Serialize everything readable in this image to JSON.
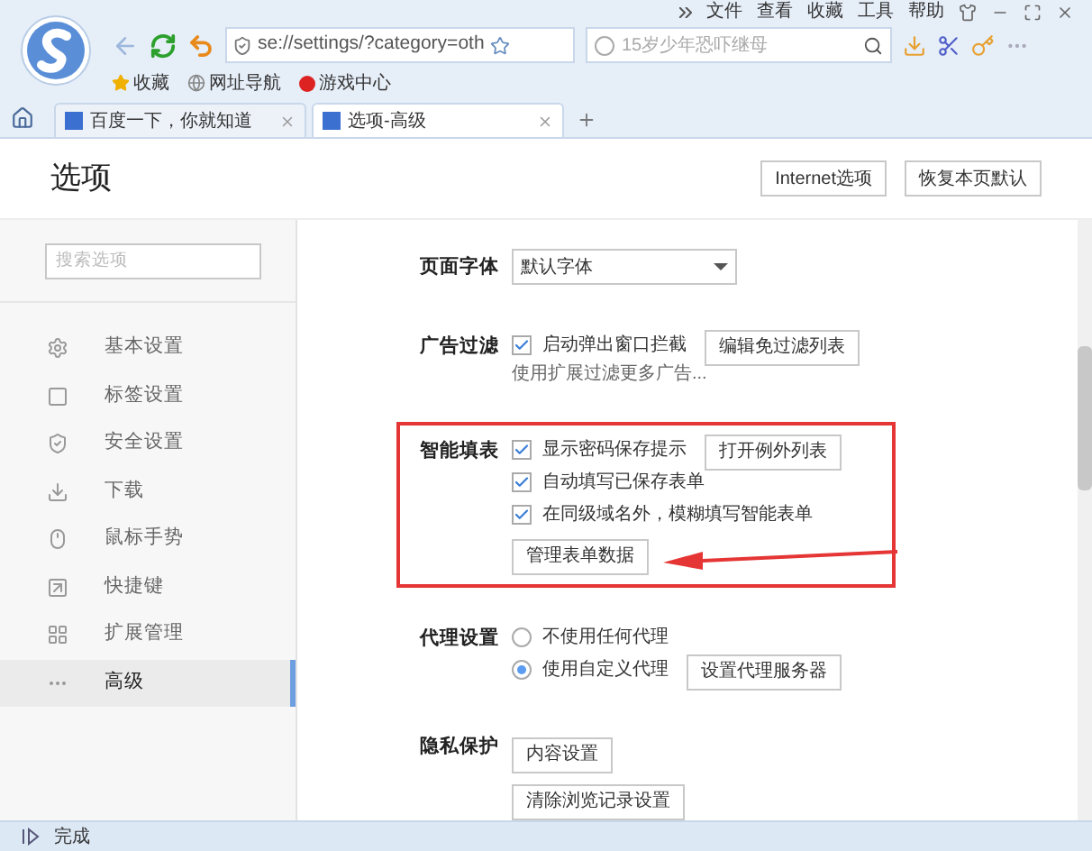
{
  "menu": [
    "文件",
    "查看",
    "收藏",
    "工具",
    "帮助"
  ],
  "address": "se://settings/?category=oth",
  "search": {
    "placeholder": "15岁少年恐吓继母"
  },
  "bookmarks": [
    "收藏",
    "网址导航",
    "游戏中心"
  ],
  "tabs": [
    {
      "label": "百度一下，你就知道",
      "selected": false
    },
    {
      "label": "选项-高级",
      "selected": true
    }
  ],
  "page": {
    "title": "选项",
    "buttons": [
      "Internet选项",
      "恢复本页默认"
    ]
  },
  "sidebar": {
    "search": {
      "placeholder": "搜索选项"
    },
    "items": [
      {
        "label": "基本设置",
        "selected": false
      },
      {
        "label": "标签设置",
        "selected": false
      },
      {
        "label": "安全设置",
        "selected": false
      },
      {
        "label": "下载",
        "selected": false
      },
      {
        "label": "鼠标手势",
        "selected": false
      },
      {
        "label": "快捷键",
        "selected": false
      },
      {
        "label": "扩展管理",
        "selected": false
      },
      {
        "label": "高级",
        "selected": true
      }
    ]
  },
  "sections": [
    {
      "label": "页面字体",
      "highlighted": false,
      "rows": [
        {
          "kind": "select",
          "value": "默认字体"
        }
      ]
    },
    {
      "label": "广告过滤",
      "highlighted": false,
      "rows": [
        {
          "kind": "checkbox",
          "text": "启动弹出窗口拦截",
          "checked": true,
          "button": "编辑免过滤列表"
        },
        {
          "kind": "link",
          "text": "使用扩展过滤更多广告..."
        }
      ]
    },
    {
      "label": "智能填表",
      "highlighted": true,
      "rows": [
        {
          "kind": "checkbox",
          "text": "显示密码保存提示",
          "checked": true,
          "button": "打开例外列表"
        },
        {
          "kind": "checkbox",
          "text": "自动填写已保存表单",
          "checked": true
        },
        {
          "kind": "checkbox",
          "text": "在同级域名外，模糊填写智能表单",
          "checked": true
        },
        {
          "kind": "button",
          "text": "管理表单数据"
        }
      ]
    },
    {
      "label": "代理设置",
      "highlighted": false,
      "rows": [
        {
          "kind": "radio",
          "text": "不使用任何代理",
          "selected": false
        },
        {
          "kind": "radio",
          "text": "使用自定义代理",
          "selected": true,
          "button": "设置代理服务器"
        }
      ]
    },
    {
      "label": "隐私保护",
      "highlighted": false,
      "rows": [
        {
          "kind": "button",
          "text": "内容设置"
        },
        {
          "kind": "button",
          "text": "清除浏览记录设置"
        }
      ]
    }
  ],
  "status_bar": "完成"
}
